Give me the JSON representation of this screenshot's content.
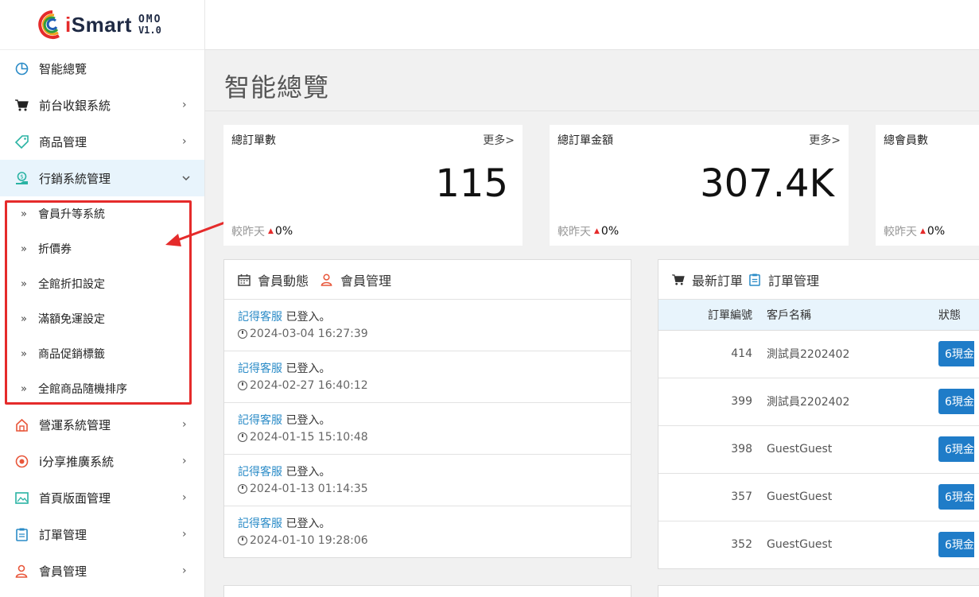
{
  "brand": {
    "name_i": "i",
    "name_rest": "Smart",
    "omo": "OMO",
    "version": "V1.0"
  },
  "sidebar": {
    "items": [
      {
        "label": "智能總覽",
        "icon": "pie-chart-icon",
        "has_arrow": false
      },
      {
        "label": "前台收銀系統",
        "icon": "cart-icon",
        "has_arrow": true
      },
      {
        "label": "商品管理",
        "icon": "tag-icon",
        "has_arrow": true
      },
      {
        "label": "行銷系統管理",
        "icon": "money-hand-icon",
        "has_arrow": true,
        "expanded": true
      }
    ],
    "submenu": [
      {
        "label": "會員升等系統"
      },
      {
        "label": "折價券"
      },
      {
        "label": "全館折扣設定"
      },
      {
        "label": "滿額免運設定"
      },
      {
        "label": "商品促銷標籤"
      },
      {
        "label": "全館商品隨機排序"
      }
    ],
    "items_after": [
      {
        "label": "營運系統管理",
        "icon": "building-icon"
      },
      {
        "label": "i分享推廣系統",
        "icon": "share-icon"
      },
      {
        "label": "首頁版面管理",
        "icon": "image-icon"
      },
      {
        "label": "訂單管理",
        "icon": "clipboard-icon"
      },
      {
        "label": "會員管理",
        "icon": "user-icon"
      }
    ],
    "arrow_glyph": "›",
    "arrow_down_glyph": "⌄",
    "sub_glyph": "»"
  },
  "page": {
    "title": "智能總覽"
  },
  "stats": [
    {
      "title": "總訂單數",
      "more": "更多>",
      "value": "115",
      "foot_label": "較昨天",
      "foot_pct": "0%"
    },
    {
      "title": "總訂單金額",
      "more": "更多>",
      "value": "307.4K",
      "foot_label": "較昨天",
      "foot_pct": "0%"
    },
    {
      "title": "總會員數",
      "more": "",
      "value": "",
      "foot_label": "較昨天",
      "foot_pct": "0%"
    }
  ],
  "member_panel": {
    "title": "會員動態",
    "link": "會員管理",
    "activities": [
      {
        "user": "記得客服",
        "action": " 已登入。",
        "time": "2024-03-04 16:27:39"
      },
      {
        "user": "記得客服",
        "action": " 已登入。",
        "time": "2024-02-27 16:40:12"
      },
      {
        "user": "記得客服",
        "action": " 已登入。",
        "time": "2024-01-15 15:10:48"
      },
      {
        "user": "記得客服",
        "action": " 已登入。",
        "time": "2024-01-13 01:14:35"
      },
      {
        "user": "記得客服",
        "action": " 已登入。",
        "time": "2024-01-10 19:28:06"
      }
    ]
  },
  "orders_panel": {
    "title": "最新訂單",
    "link": "訂單管理",
    "columns": [
      "訂單編號",
      "客戶名稱",
      "狀態"
    ],
    "rows": [
      {
        "id": "414",
        "customer": "測試員2202402",
        "status": "6現金"
      },
      {
        "id": "399",
        "customer": "測試員2202402",
        "status": "6現金"
      },
      {
        "id": "398",
        "customer": "GuestGuest",
        "status": "6現金"
      },
      {
        "id": "357",
        "customer": "GuestGuest",
        "status": "6現金"
      },
      {
        "id": "352",
        "customer": "GuestGuest",
        "status": "6現金"
      }
    ]
  },
  "colors": {
    "accent": "#1f7cc8",
    "link": "#2a8bc7",
    "annotation": "#e52b2b",
    "active_bg": "#e8f4fc"
  }
}
